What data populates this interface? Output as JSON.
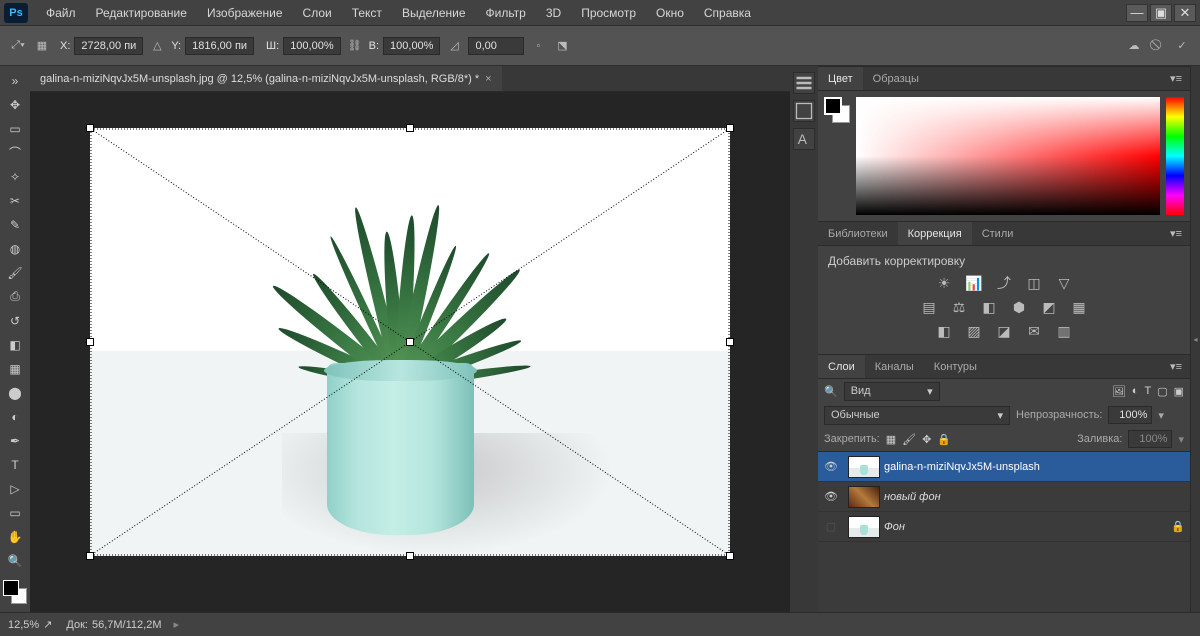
{
  "app": {
    "badge": "Ps"
  },
  "menu": [
    "Файл",
    "Редактирование",
    "Изображение",
    "Слои",
    "Текст",
    "Выделение",
    "Фильтр",
    "3D",
    "Просмотр",
    "Окно",
    "Справка"
  ],
  "options": {
    "x_label": "X:",
    "x_val": "2728,00 пи",
    "y_label": "Y:",
    "y_val": "1816,00 пи",
    "w_label": "Ш:",
    "w_val": "100,00%",
    "h_label": "В:",
    "h_val": "100,00%",
    "angle_val": "0,00"
  },
  "doc": {
    "title": "galina-n-miziNqvJx5M-unsplash.jpg @ 12,5% (galina-n-miziNqvJx5M-unsplash, RGB/8*) *"
  },
  "panels": {
    "color": {
      "tabs": [
        "Цвет",
        "Образцы"
      ],
      "active": 0
    },
    "adjust": {
      "tabs": [
        "Библиотеки",
        "Коррекция",
        "Стили"
      ],
      "active": 1,
      "heading": "Добавить корректировку"
    },
    "layers": {
      "tabs": [
        "Слои",
        "Каналы",
        "Контуры"
      ],
      "active": 0,
      "filter_label": "Вид",
      "blend": "Обычные",
      "opacity_label": "Непрозрачность:",
      "opacity": "100%",
      "lock_label": "Закрепить:",
      "fill_label": "Заливка:",
      "fill": "100%",
      "items": [
        {
          "visible": true,
          "name": "galina-n-miziNqvJx5M-unsplash",
          "locked": false,
          "selected": true
        },
        {
          "visible": true,
          "name": "новый фон",
          "locked": false,
          "selected": false
        },
        {
          "visible": false,
          "name": "Фон",
          "locked": true,
          "selected": false
        }
      ]
    }
  },
  "status": {
    "zoom": "12,5%",
    "doc_label": "Док:",
    "doc_size": "56,7M/112,2M"
  }
}
